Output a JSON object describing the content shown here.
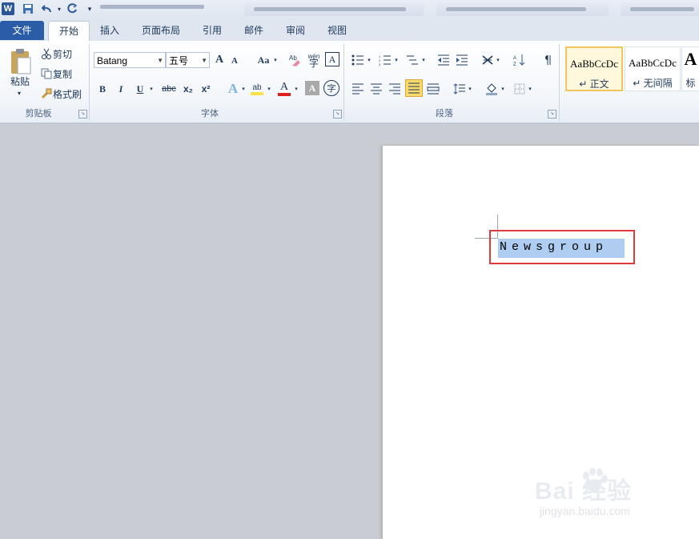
{
  "tabs": [
    {
      "label": "文件"
    },
    {
      "label": "开始"
    },
    {
      "label": "插入"
    },
    {
      "label": "页面布局"
    },
    {
      "label": "引用"
    },
    {
      "label": "邮件"
    },
    {
      "label": "审阅"
    },
    {
      "label": "视图"
    }
  ],
  "clipboard": {
    "paste": "粘贴",
    "cut": "剪切",
    "copy": "复制",
    "format_painter": "格式刷",
    "group_label": "剪贴板"
  },
  "font": {
    "name": "Batang",
    "size": "五号",
    "group_label": "字体",
    "grow": "A",
    "shrink": "A",
    "case": "Aa",
    "bold": "B",
    "italic": "I",
    "underline": "U",
    "strike": "abc",
    "sub": "x₂",
    "sup": "x²",
    "text_effect": "A",
    "highlight": "ab",
    "font_color": "A",
    "char_shade": "A",
    "char_border": "A",
    "pinyin": "wén",
    "enclose": "字"
  },
  "paragraph": {
    "group_label": "段落"
  },
  "styles": [
    {
      "sample": "AaBbCcDc",
      "name": "↵ 正文"
    },
    {
      "sample": "AaBbCcDc",
      "name": "↵ 无间隔"
    },
    {
      "sample": "A",
      "name": "标"
    }
  ],
  "document": {
    "text": "Newsgroup"
  },
  "watermark": {
    "brand": "Bai  经验",
    "url": "jingyan.baidu.com"
  },
  "colors": {
    "file_tab": "#2a5ca8",
    "selection": "#aecdf0",
    "annotation": "#e03a3a"
  }
}
